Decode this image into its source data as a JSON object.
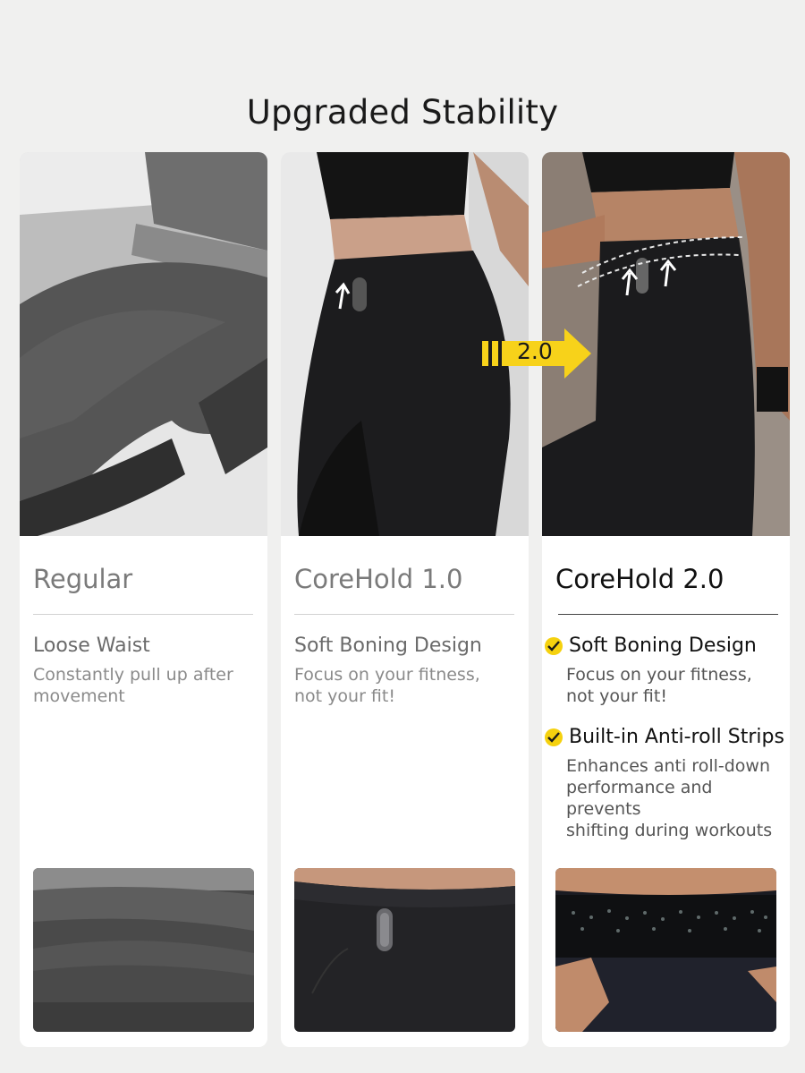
{
  "page": {
    "title": "Upgraded Stability"
  },
  "badge": {
    "label": "2.0",
    "color": "#f7d21a"
  },
  "accent_color": "#f5d10e",
  "columns": [
    {
      "title": "Regular",
      "features": [
        {
          "heading": "Loose Waist",
          "body_line1": "Constantly pull up after",
          "body_line2": "movement"
        }
      ]
    },
    {
      "title": "CoreHold 1.0",
      "features": [
        {
          "heading": "Soft Boning Design",
          "body_line1": "Focus on your fitness,",
          "body_line2": "not your fit!"
        }
      ]
    },
    {
      "title": "CoreHold 2.0",
      "features": [
        {
          "heading": "Soft Boning Design",
          "body_line1": "Focus on your fitness,",
          "body_line2": "not your fit!",
          "icon": "check-circle-icon"
        },
        {
          "heading": "Built-in Anti-roll Strips",
          "body_line1": "Enhances anti roll-down",
          "body_line2": "performance and prevents",
          "body_line3": "shifting during workouts",
          "icon": "check-circle-icon"
        }
      ]
    }
  ]
}
